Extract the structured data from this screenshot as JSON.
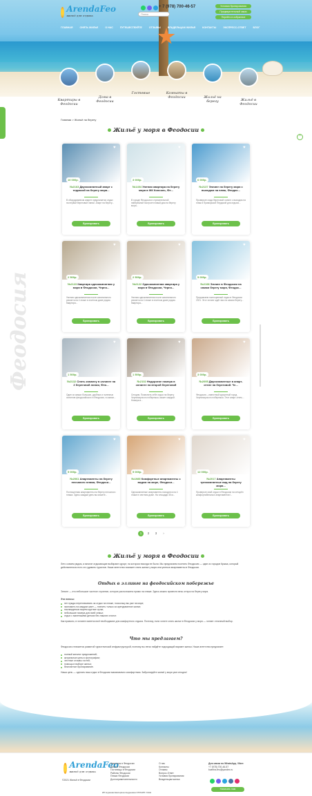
{
  "header": {
    "logo_title": "ArendaFeo",
    "logo_sub": "жильё для отдыха",
    "phone": "+ 7 (978) 700-46-57",
    "search_placeholder": "Поиск",
    "buttons": [
      "Условия бронирования",
      "Предварительный заказ",
      "Перейти в избранное"
    ],
    "nav": [
      "ГЛАВНАЯ",
      "СНЯТЬ ЖИЛЬЕ",
      "О НАС",
      "ПУТЕШЕСТВУЙТЕ",
      "ОТЗЫВЫ",
      "ВЛАДЕЛЬЦАМ ЖИЛЬЯ",
      "КОНТАКТЫ",
      "ЭКСПРЕСС-ОТВЕТ",
      "БЛОГ"
    ]
  },
  "categories": [
    "Квартиры в Феодосии",
    "Дома в Феодосии",
    "Гостевые",
    "Комнаты в Феодосии",
    "Жильё на берегу",
    "Жильё в Феодосии"
  ],
  "breadcrumb": "Главная > Жильё на берегу",
  "listing_title": "Жильё у моря в Феодосии",
  "watermark": "Феодосия",
  "cards": [
    {
      "price": "10 000р.",
      "id": "№2163",
      "name": "Двухкомнатный апарт с террасой на берегу моря...",
      "desc": "В оборудованном апарте предлагается отдых на первой береговой линии. Апарт на берегу...",
      "book": "Бронировать"
    },
    {
      "price": "3 000р.",
      "id": "№1404",
      "name": "Уютная квартира на берегу моря в ЖК Консоль, Фе...",
      "desc": "В городе Феодосия в стремительной набережной построен новый дом на берегу моря...",
      "book": "Бронировать"
    },
    {
      "price": "6 000р.",
      "id": "№2137",
      "name": "Эллинг на берегу моря с выходом на пляж, Феодос...",
      "desc": "Проверьте сюда береговой эллинг с выходом на пляж в Приморской Пердской для отдыха...",
      "book": "Бронировать"
    },
    {
      "price": "2 500р.",
      "id": "№2123",
      "name": "Квартира однокомнатная у моря в Феодосии, Черно...",
      "desc": "Уютная однокомнатная после капитального ремонта на 4 этаже в элитном доме рядом. Квартира...",
      "book": "Бронировать"
    },
    {
      "price": "2 500р.",
      "id": "№2122",
      "name": "Однокомнатная квартира у моря в Феодосии, Черно...",
      "desc": "Уютная однокомнатная после капитального ремонта на 4 этаже в элитном доме рядом. Квартира...",
      "book": "Бронировать"
    },
    {
      "price": "5 000р.",
      "id": "№2198",
      "name": "Эллинг в Феодосии на самом берегу моря, Феодос...",
      "desc": "Предлагаем полноценный отдых в Феодосии 2021. Этот эллинг ждёт вас на самом берегу...",
      "book": "Бронировать"
    },
    {
      "price": "1 500р.",
      "id": "№2132",
      "name": "Снять комнату в эллинге на 2 береговой линии, Фео...",
      "desc": "Один из самых больших, удобных и полезных эллингов феодосийского в Феодосии, в самом...",
      "book": "Бронировать"
    },
    {
      "price": "1 500р.",
      "id": "№2102",
      "name": "Недорогие номера в эллинге на второй береговой",
      "desc": "Сегодня. Позвонить себе отдых на берегу Черноморского побережья, может каждый. Номера в...",
      "book": "Бронировать"
    },
    {
      "price": "3 000р.",
      "id": "№2095",
      "name": "Двухкомнатные в апарт-отеле на береговой. Че...",
      "desc": "Феодосия – известный курортный город Черноморского побережья. Этот апарт-отель...",
      "book": "Бронировать"
    },
    {
      "price": "5 000р.",
      "id": "№2061",
      "name": "Апартаменты на берегу песчаного пляжа, Феодоси...",
      "desc": "Полноценная апартаменты на берегу песчаного пляжа. Здесь каждый день вы можете...",
      "book": "Бронировать"
    },
    {
      "price": "5 000р.",
      "id": "№1985",
      "name": "Комфортные апартаменты с видом на море, Феодоси...",
      "desc": "Однокомнатные апартаменты находятся на 4 этаже в элитном доме. На площади 35 м...",
      "book": "Бронировать"
    },
    {
      "price": "12 000р.",
      "id": "№2017",
      "name": "Апартаменты трехкомнатные вид на берегу моря...",
      "desc": "Проверьте свой отдых в Феодосии на четырёх комфортабельных апартаментах!...",
      "book": "Бронировать"
    }
  ],
  "pager": [
    "1",
    "2",
    "3",
    "›"
  ],
  "about": {
    "title": "Жильё у моря в Феодосии",
    "p1": "Лето совсем рядом, а многие отдыхающие выбирают курорт, на котором никогда не были. Мы предлагаем посетить Феодосию — один из городов Крыма, который действительно есть что удивить туристов. Наше агентство поможет снять жилье у моря или уютные апартаменты в Феодосии.",
    "h2": "Отдых в эллинге на феодосийском побережье",
    "p2": "Эллинг — это небольшое частное строение, которое расположено прямо на пляже. Здесь можно провести весь отпуск на берегу моря.",
    "benefits_title": "Эти плюсы:",
    "benefits": [
      "нет нужды переплачивать за отдых на пляже, поскольку вы уже на море;",
      "экономить на каждом шаге — платить только за арендованное жилье;",
      "наслаждаться морем круглые сутки;",
      "небольшие номера для всей семьи;",
      "отдых с маленькими детьми без лишних хлопот."
    ],
    "p3": "Как правило, в эллинге имеется всё необходимое для комфортного отдыха. Поэтому, если хотите снять жилье в Феодосии у моря — эллинг отличный выбор.",
    "h3": "Что мы предлагаем?",
    "p4": "Феодосия отличается развитой туристической инфраструктурой, поэтому вы легко найдёте подходящий вариант жилья. Наше агентство предлагает:",
    "offers": [
      "полный каталог предложений;",
      "актуальные цены и фотографии;",
      "честные отзывы гостей;",
      "помощь в выборе жилья;",
      "бесплатное бронирование."
    ],
    "p5": "Наша цель — сделать ваш отдых в Феодосии максимально комфортным. Забронируйте жильё у моря уже сегодня!"
  },
  "footer": {
    "copyright": "©2021 Жильё в Феодосии",
    "col1": [
      "Квартиры в Феодосии",
      "Дома в Феодосии",
      "Гостиницы в Феодосии",
      "Районы Феодосии",
      "Пляжи Феодосии",
      "Достопримечательности"
    ],
    "col2": [
      "О нас",
      "Контакты",
      "Отзывы",
      "Вопрос-Ответ",
      "Условия бронирования",
      "Владельцам жилья"
    ],
    "contact_title": "Для связи по WhatsApp, Viber:",
    "contact_phone": "+7 (978) 700-46-57",
    "contact_email": "kvartira-feo@yandex.ru",
    "button": "Написать нам",
    "bottom_line": "ИП Нуриева Екатерина Андреевна ОГРНИП / ИНН"
  }
}
